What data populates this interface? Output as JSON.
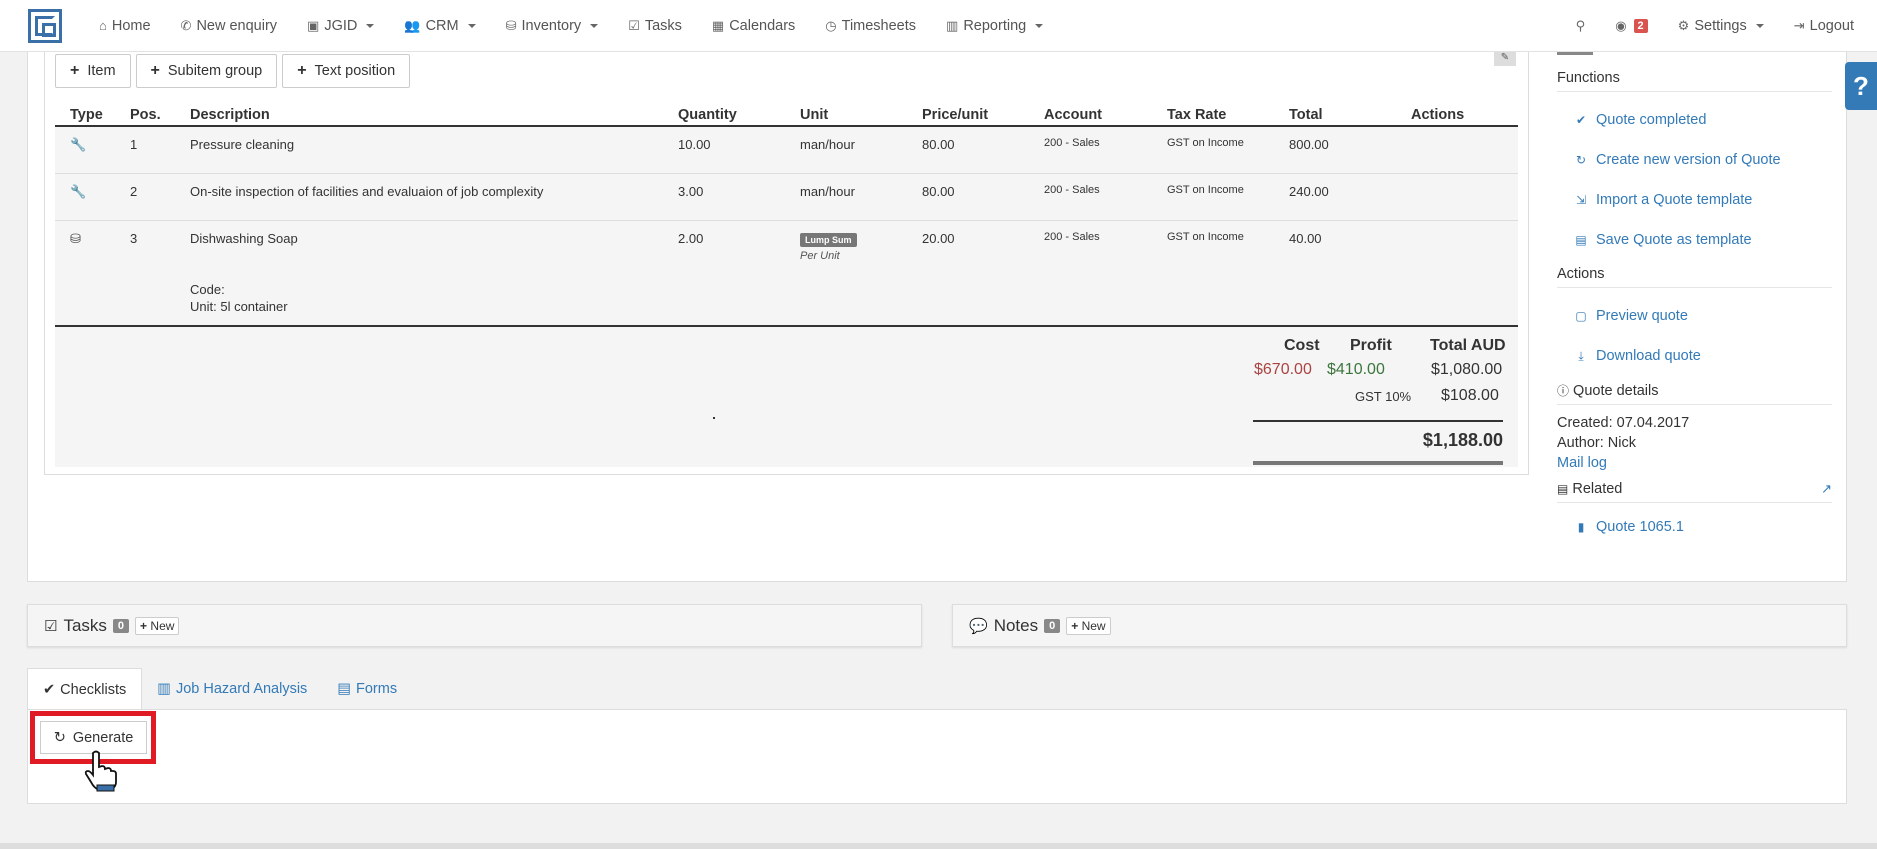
{
  "nav": {
    "items": [
      {
        "icon": "home-icon",
        "glyph": "⌂",
        "label": "Home"
      },
      {
        "icon": "phone-icon",
        "glyph": "✆",
        "label": "New enquiry"
      },
      {
        "icon": "logo-small-icon",
        "glyph": "▣",
        "label": "JGID"
      },
      {
        "icon": "users-icon",
        "glyph": "👥",
        "label": "CRM"
      },
      {
        "icon": "cubes-icon",
        "glyph": "⛁",
        "label": "Inventory"
      },
      {
        "icon": "check-square-icon",
        "glyph": "☑",
        "label": "Tasks"
      },
      {
        "icon": "calendar-icon",
        "glyph": "▦",
        "label": "Calendars"
      },
      {
        "icon": "clock-icon",
        "glyph": "◷",
        "label": "Timesheets"
      },
      {
        "icon": "bar-chart-icon",
        "glyph": "▥",
        "label": "Reporting"
      }
    ],
    "notification_count": "2",
    "settings_label": "Settings",
    "logout_label": "Logout"
  },
  "toolbar": {
    "item_label": "Item",
    "subitem_label": "Subitem group",
    "text_label": "Text position"
  },
  "table": {
    "headers": [
      "Type",
      "Pos.",
      "Description",
      "Quantity",
      "Unit",
      "Price/unit",
      "Account",
      "Tax Rate",
      "Total",
      "Actions"
    ],
    "rows": [
      {
        "pos": "1",
        "description": "Pressure cleaning",
        "quantity": "10.00",
        "unit": "man/hour",
        "price": "80.00",
        "account": "200 - Sales",
        "tax": "GST on Income",
        "total": "800.00"
      },
      {
        "pos": "2",
        "description": "On-site inspection of facilities and evaluaion of job complexity",
        "quantity": "3.00",
        "unit": "man/hour",
        "price": "80.00",
        "account": "200 - Sales",
        "tax": "GST on Income",
        "total": "240.00"
      },
      {
        "pos": "3",
        "description": "Dishwashing Soap",
        "code": "Code:",
        "unit_info": "Unit: 5l container",
        "quantity": "2.00",
        "unit_badge": "Lump Sum",
        "unit_sub": "Per Unit",
        "price": "20.00",
        "account": "200 - Sales",
        "tax": "GST on Income",
        "total": "40.00"
      }
    ]
  },
  "totals": {
    "cost_label": "Cost",
    "profit_label": "Profit",
    "total_label": "Total AUD",
    "cost": "$670.00",
    "profit": "$410.00",
    "total": "$1,080.00",
    "gst_label": "GST 10%",
    "gst": "$108.00",
    "grand_total": "$1,188.00",
    "cost_color": "#a94442",
    "profit_color": "#3c763d"
  },
  "sidebar": {
    "functions_title": "Functions",
    "functions": [
      "Quote completed",
      "Create new version of Quote",
      "Import a Quote template",
      "Save Quote as template"
    ],
    "actions_title": "Actions",
    "actions": [
      "Preview quote",
      "Download quote"
    ],
    "details_title": "Quote details",
    "created": "Created: 07.04.2017",
    "author": "Author: Nick",
    "mail_log": "Mail log",
    "related_title": "Related",
    "related_link": "Quote 1065.1"
  },
  "tasks": {
    "title": "Tasks",
    "count": "0",
    "new_label": "New"
  },
  "notes": {
    "title": "Notes",
    "count": "0",
    "new_label": "New"
  },
  "tabs": [
    "Checklists",
    "Job Hazard Analysis",
    "Forms"
  ],
  "generate_label": "Generate",
  "colors": {
    "accent": "#337ab7",
    "highlight": "#e01b24"
  }
}
